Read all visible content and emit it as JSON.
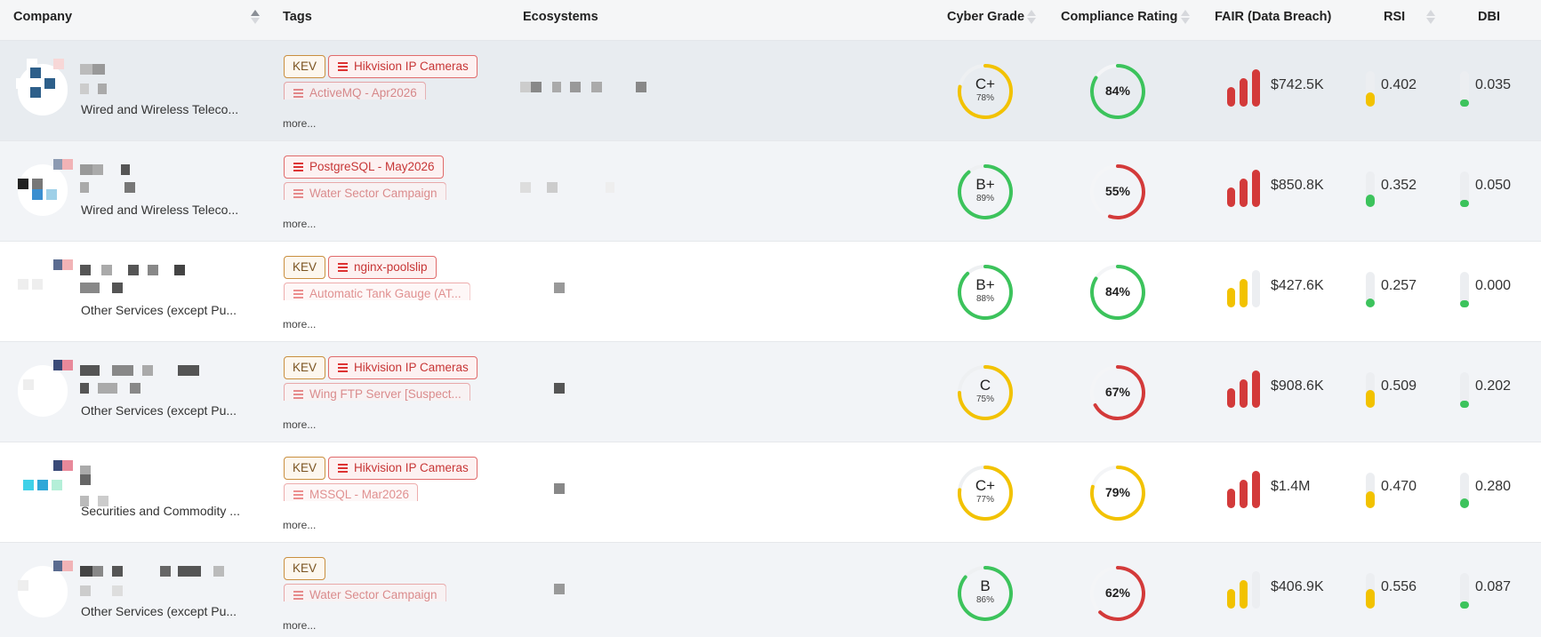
{
  "header": {
    "company": "Company",
    "tags": "Tags",
    "ecosystems": "Ecosystems",
    "cyber_grade": "Cyber Grade",
    "compliance": "Compliance Rating",
    "fair": "FAIR (Data Breach)",
    "rsi": "RSI",
    "dbi": "DBI"
  },
  "colors": {
    "green": "#3cc35c",
    "yellow": "#f2c200",
    "red": "#d33a3a",
    "header_bg": "#f5f6f7"
  },
  "more_label": "more...",
  "rows": [
    {
      "industry": "Wired and Wireless Teleco...",
      "tag1": "KEV",
      "tag2": "Hikvision IP Cameras",
      "tag3": "ActiveMQ - Apr2026",
      "grade": "C+",
      "grade_pct": "78%",
      "grade_value": 78,
      "grade_color": "#f2c200",
      "compliance": "84%",
      "compliance_value": 84,
      "compliance_color": "#3cc35c",
      "fair": "$742.5K",
      "fair_level": "high",
      "rsi": "0.402",
      "rsi_value": 0.402,
      "dbi": "0.035",
      "dbi_value": 0.035
    },
    {
      "industry": "Wired and Wireless Teleco...",
      "tag1": "",
      "tag2": "PostgreSQL - May2026",
      "tag3": "Water Sector Campaign",
      "grade": "B+",
      "grade_pct": "89%",
      "grade_value": 89,
      "grade_color": "#3cc35c",
      "compliance": "55%",
      "compliance_value": 55,
      "compliance_color": "#d33a3a",
      "fair": "$850.8K",
      "fair_level": "high",
      "rsi": "0.352",
      "rsi_value": 0.352,
      "dbi": "0.050",
      "dbi_value": 0.05
    },
    {
      "industry": "Other Services (except Pu...",
      "tag1": "KEV",
      "tag2": "nginx-poolslip",
      "tag3": "Automatic Tank Gauge (AT...",
      "grade": "B+",
      "grade_pct": "88%",
      "grade_value": 88,
      "grade_color": "#3cc35c",
      "compliance": "84%",
      "compliance_value": 84,
      "compliance_color": "#3cc35c",
      "fair": "$427.6K",
      "fair_level": "medium",
      "rsi": "0.257",
      "rsi_value": 0.257,
      "dbi": "0.000",
      "dbi_value": 0.0
    },
    {
      "industry": "Other Services (except Pu...",
      "tag1": "KEV",
      "tag2": "Hikvision IP Cameras",
      "tag3": "Wing FTP Server [Suspect...",
      "grade": "C",
      "grade_pct": "75%",
      "grade_value": 75,
      "grade_color": "#f2c200",
      "compliance": "67%",
      "compliance_value": 67,
      "compliance_color": "#d33a3a",
      "fair": "$908.6K",
      "fair_level": "high",
      "rsi": "0.509",
      "rsi_value": 0.509,
      "dbi": "0.202",
      "dbi_value": 0.202
    },
    {
      "industry": "Securities and Commodity ...",
      "tag1": "KEV",
      "tag2": "Hikvision IP Cameras",
      "tag3": "MSSQL - Mar2026",
      "grade": "C+",
      "grade_pct": "77%",
      "grade_value": 77,
      "grade_color": "#f2c200",
      "compliance": "79%",
      "compliance_value": 79,
      "compliance_color": "#f2c200",
      "fair": "$1.4M",
      "fair_level": "high",
      "rsi": "0.470",
      "rsi_value": 0.47,
      "dbi": "0.280",
      "dbi_value": 0.28
    },
    {
      "industry": "Other Services (except Pu...",
      "tag1": "KEV",
      "tag2": "",
      "tag3": "Water Sector Campaign",
      "grade": "B",
      "grade_pct": "86%",
      "grade_value": 86,
      "grade_color": "#3cc35c",
      "compliance": "62%",
      "compliance_value": 62,
      "compliance_color": "#d33a3a",
      "fair": "$406.9K",
      "fair_level": "medium",
      "rsi": "0.556",
      "rsi_value": 0.556,
      "dbi": "0.087",
      "dbi_value": 0.087
    }
  ]
}
